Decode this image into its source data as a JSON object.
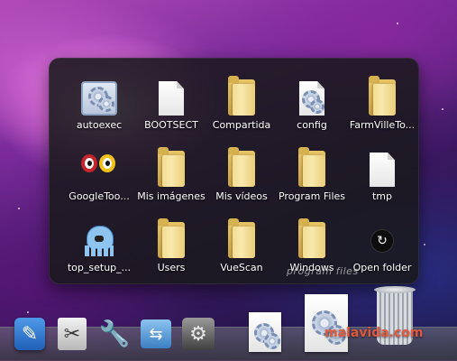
{
  "stack": {
    "items": [
      {
        "label": "autoexec",
        "icon": "exec-settings-icon",
        "type": "executable"
      },
      {
        "label": "BOOTSECT",
        "icon": "document-icon",
        "type": "document"
      },
      {
        "label": "Compartida",
        "icon": "folder-icon",
        "type": "folder"
      },
      {
        "label": "config",
        "icon": "settings-document-icon",
        "type": "settings"
      },
      {
        "label": "FarmVilleTo...",
        "icon": "folder-icon",
        "type": "folder"
      },
      {
        "label": "GoogleToo...",
        "icon": "google-toolbar-icon",
        "type": "app"
      },
      {
        "label": "Mis imágenes",
        "icon": "folder-icon",
        "type": "folder"
      },
      {
        "label": "Mis vídeos",
        "icon": "folder-icon",
        "type": "folder"
      },
      {
        "label": "Program Files",
        "icon": "folder-icon",
        "type": "folder"
      },
      {
        "label": "tmp",
        "icon": "document-icon",
        "type": "document"
      },
      {
        "label": "top_setup_...",
        "icon": "octopus-installer-icon",
        "type": "app"
      },
      {
        "label": "Users",
        "icon": "folder-icon",
        "type": "folder"
      },
      {
        "label": "VueScan",
        "icon": "folder-icon",
        "type": "folder"
      },
      {
        "label": "Windows",
        "icon": "folder-icon",
        "type": "folder"
      },
      {
        "label": "Open folder",
        "icon": "open-folder-arrow-icon",
        "type": "action"
      }
    ]
  },
  "fan_hint": "program files",
  "dock": {
    "items": [
      {
        "name": "safari-pencil-icon"
      },
      {
        "name": "scissors-preview-icon"
      },
      {
        "name": "wrench-icon"
      },
      {
        "name": "network-icon"
      },
      {
        "name": "system-preferences-icon"
      },
      {
        "name": "settings-document-icon"
      },
      {
        "name": "settings-document-large-icon"
      },
      {
        "name": "trash-icon"
      }
    ]
  },
  "watermark": "malavida.com"
}
